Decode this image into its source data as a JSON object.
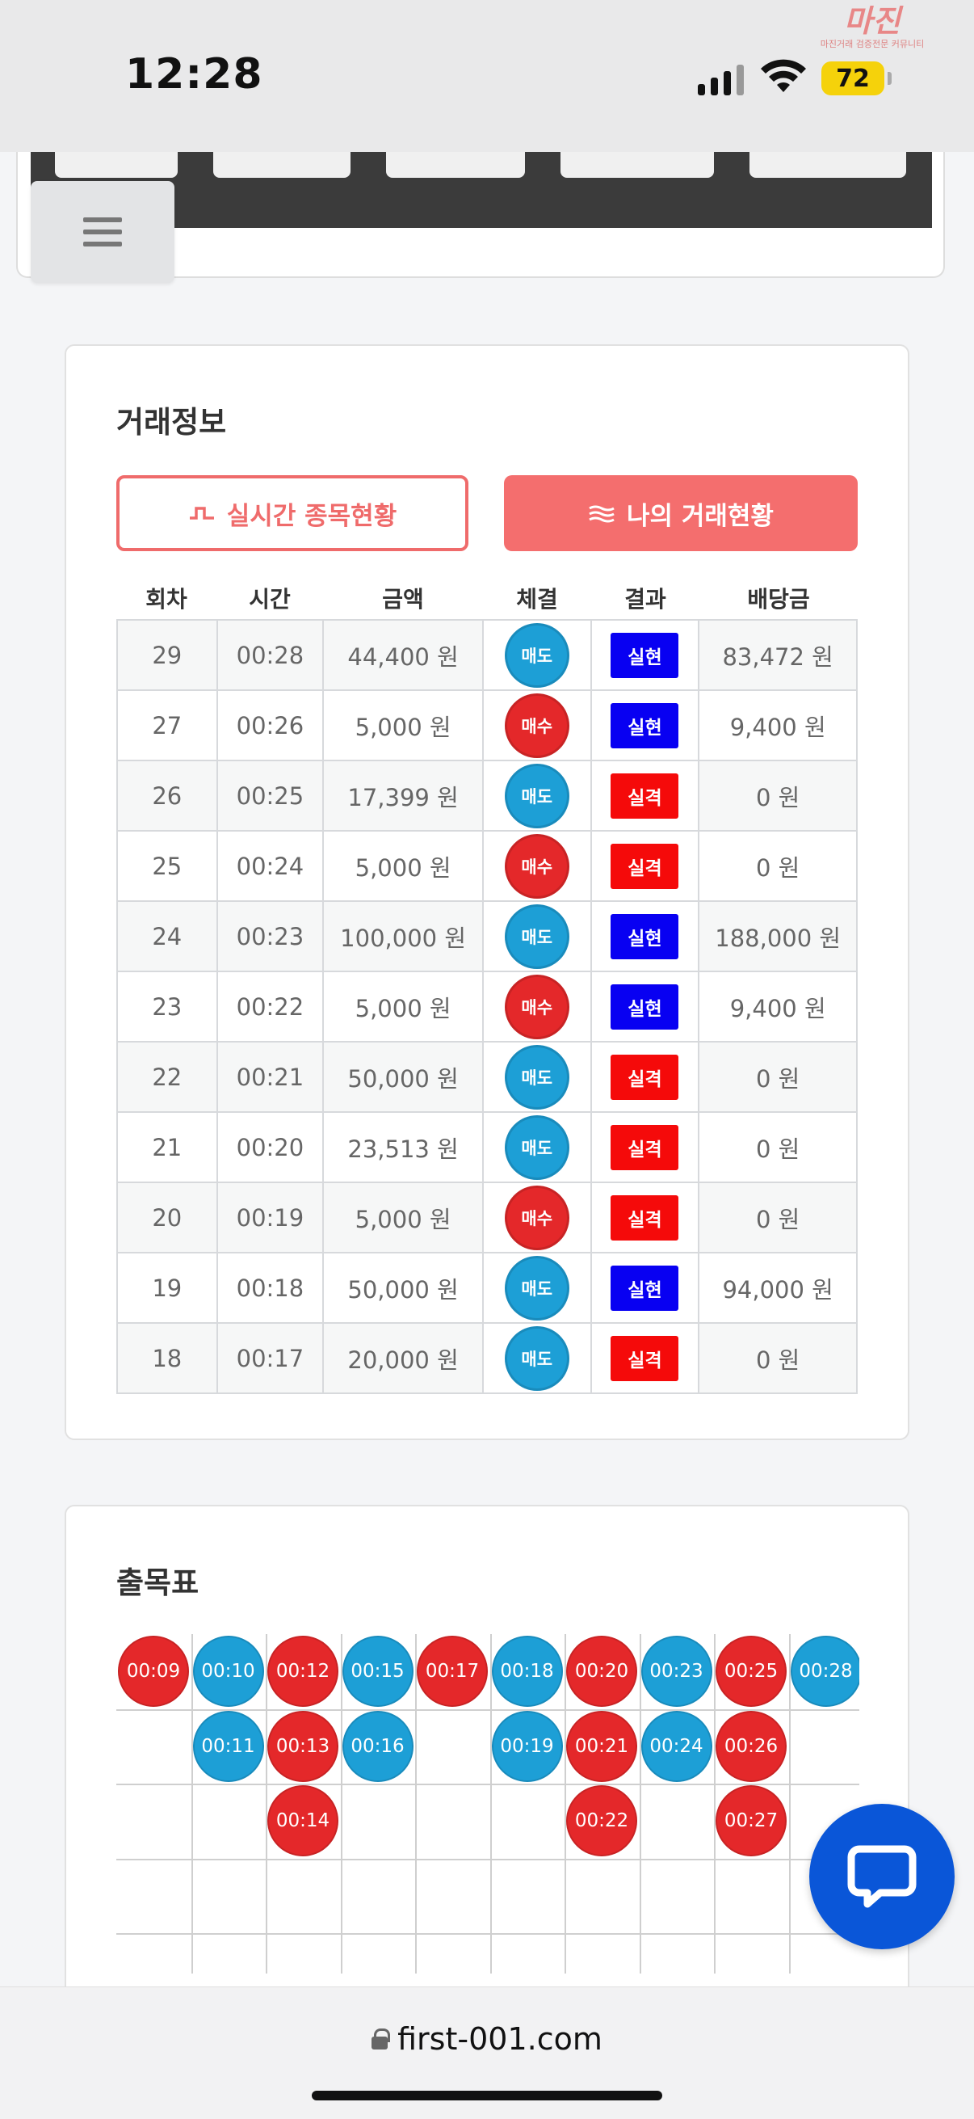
{
  "status": {
    "time": "12:28",
    "battery": "72"
  },
  "watermark": {
    "logo": "마진",
    "sub": "마진거래 검증전문 커뮤니티"
  },
  "trade": {
    "title": "거래정보",
    "tab_live": "실시간 종목현황",
    "tab_mine": "나의 거래현황",
    "headers": [
      "회차",
      "시간",
      "금액",
      "체결",
      "결과",
      "배당금"
    ],
    "rows": [
      {
        "round": "29",
        "time": "00:28",
        "amount": "44,400 원",
        "exec": "매도",
        "result": "실현",
        "payout": "83,472 원"
      },
      {
        "round": "27",
        "time": "00:26",
        "amount": "5,000 원",
        "exec": "매수",
        "result": "실현",
        "payout": "9,400 원"
      },
      {
        "round": "26",
        "time": "00:25",
        "amount": "17,399 원",
        "exec": "매도",
        "result": "실격",
        "payout": "0 원"
      },
      {
        "round": "25",
        "time": "00:24",
        "amount": "5,000 원",
        "exec": "매수",
        "result": "실격",
        "payout": "0 원"
      },
      {
        "round": "24",
        "time": "00:23",
        "amount": "100,000 원",
        "exec": "매도",
        "result": "실현",
        "payout": "188,000 원"
      },
      {
        "round": "23",
        "time": "00:22",
        "amount": "5,000 원",
        "exec": "매수",
        "result": "실현",
        "payout": "9,400 원"
      },
      {
        "round": "22",
        "time": "00:21",
        "amount": "50,000 원",
        "exec": "매도",
        "result": "실격",
        "payout": "0 원"
      },
      {
        "round": "21",
        "time": "00:20",
        "amount": "23,513 원",
        "exec": "매도",
        "result": "실격",
        "payout": "0 원"
      },
      {
        "round": "20",
        "time": "00:19",
        "amount": "5,000 원",
        "exec": "매수",
        "result": "실격",
        "payout": "0 원"
      },
      {
        "round": "19",
        "time": "00:18",
        "amount": "50,000 원",
        "exec": "매도",
        "result": "실현",
        "payout": "94,000 원"
      },
      {
        "round": "18",
        "time": "00:17",
        "amount": "20,000 원",
        "exec": "매도",
        "result": "실격",
        "payout": "0 원"
      }
    ]
  },
  "road": {
    "title": "출목표",
    "columns": [
      {
        "color": "red",
        "times": [
          "00:09"
        ]
      },
      {
        "color": "blue",
        "times": [
          "00:10",
          "00:11"
        ]
      },
      {
        "color": "red",
        "times": [
          "00:12",
          "00:13",
          "00:14"
        ]
      },
      {
        "color": "blue",
        "times": [
          "00:15",
          "00:16"
        ]
      },
      {
        "color": "red",
        "times": [
          "00:17"
        ]
      },
      {
        "color": "blue",
        "times": [
          "00:18",
          "00:19"
        ]
      },
      {
        "color": "red",
        "times": [
          "00:20",
          "00:21",
          "00:22"
        ]
      },
      {
        "color": "blue",
        "times": [
          "00:23",
          "00:24"
        ]
      },
      {
        "color": "red",
        "times": [
          "00:25",
          "00:26",
          "00:27"
        ]
      },
      {
        "color": "blue",
        "times": [
          "00:28"
        ]
      }
    ]
  },
  "browser": {
    "url": "first-001.com"
  },
  "colors": {
    "accent": "#f46e6e",
    "sell": "#1d9fd6",
    "buy": "#e4282a",
    "win": "#0800f2",
    "lose": "#f50a0a",
    "chat": "#0a56d8"
  },
  "icons": {
    "chat": "chat-bubble-icon",
    "menu": "hamburger-icon",
    "pulse": "pulse-icon",
    "waves": "waves-icon",
    "lock": "lock-icon"
  }
}
